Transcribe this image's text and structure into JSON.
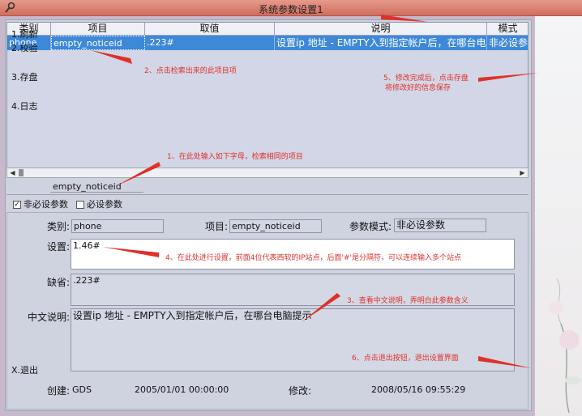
{
  "window": {
    "title": "系统参数设置1"
  },
  "grid": {
    "columns": [
      "类别",
      "项目",
      "取值",
      "说明",
      "模式"
    ],
    "rows": [
      {
        "category": "phone",
        "item": "empty_noticeid",
        "value": ".223#",
        "desc": "设置ip 地址 - EMPTY入到指定帐户后，在哪台电脑提",
        "mode": "非必设参"
      }
    ]
  },
  "search": {
    "value": "empty_noticeid"
  },
  "filters": {
    "non_required": "非必设参数",
    "non_required_checked": true,
    "required": "必设参数",
    "required_checked": false
  },
  "form": {
    "category_label": "类别:",
    "category_value": "phone",
    "item_label": "项目:",
    "item_value": "empty_noticeid",
    "mode_label": "参数模式:",
    "mode_value": "非必设参数",
    "setting_label": "设置:",
    "setting_value": "1.46#",
    "default_label": "缺省:",
    "default_value": ".223#",
    "desc_label": "中文说明:",
    "desc_value": "设置ip 地址 - EMPTY入到指定帐户后，在哪台电脑提示",
    "created_label": "创建:",
    "created_by": "GDS",
    "created_time": "2005/01/01 00:00:00",
    "modified_label": "修改:",
    "modified_time": "2008/05/16 09:55:29"
  },
  "sidebar": {
    "refresh": "1.刷新",
    "verify": "2.校验",
    "save": "3.存盘",
    "log": "4.日志",
    "exit": "X.退出"
  },
  "annotations": {
    "a1": "1、在此处输入如下字母，检索相同的项目",
    "a2": "2、点击检索出来的此项目项",
    "a3": "3、查看中文说明，弄明白此参数含义",
    "a4": "4、在此处进行设置，前面4位代表西软的IP站点，后面'#'是分隔符，可以连续输入多个站点",
    "a5_line1": "5、修改完成后，点击存盘",
    "a5_line2": "将修改好的信息保存",
    "a6": "6、点击退出按钮，退出设置界面"
  },
  "colors": {
    "selection": "#3d88d8",
    "annotation": "#e0302a",
    "titlebar": "#d9796a"
  }
}
